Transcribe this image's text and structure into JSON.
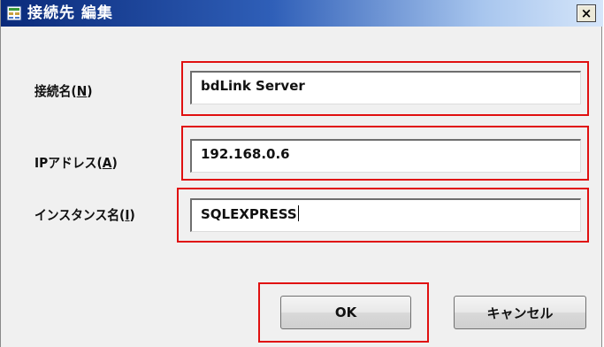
{
  "dialog": {
    "title": "接続先 編集",
    "close_label": "×"
  },
  "fields": {
    "connection_name": {
      "label": "接続名(",
      "accesskey": "N",
      "label_suffix": ")",
      "value": "bdLink Server"
    },
    "ip_address": {
      "label": "IPアドレス(",
      "accesskey": "A",
      "label_suffix": ")",
      "value": "192.168.0.6"
    },
    "instance_name": {
      "label": "インスタンス名(",
      "accesskey": "I",
      "label_suffix": ")",
      "value": "SQLEXPRESS"
    }
  },
  "buttons": {
    "ok": "OK",
    "cancel": "キャンセル"
  },
  "colors": {
    "highlight": "#e01010",
    "titlebar_start": "#0a2a7a",
    "titlebar_end": "#d6e6fa"
  },
  "icons": {
    "app": "database-grid-icon",
    "close": "close-icon"
  }
}
